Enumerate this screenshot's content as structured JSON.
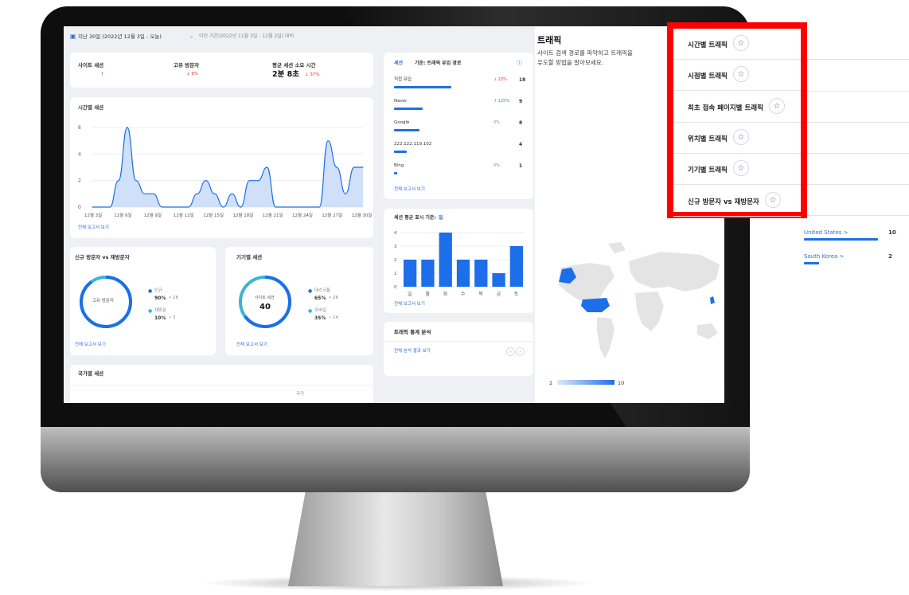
{
  "date_range": {
    "label": "지난 30일 (2022년 12월 3일 - 오늘)",
    "compare": "이전 기간(2022년 11월 3일 - 12월 2일) 대비"
  },
  "stats": {
    "site_sessions": {
      "label": "사이트 세션",
      "delta": "↑"
    },
    "unique_visitors": {
      "label": "고유 방문자",
      "delta": "↓ 6%"
    },
    "avg_duration": {
      "label": "평균 세션 소요 시간",
      "value": "2분 8초",
      "delta": "↓ 37%"
    }
  },
  "sessions_over_time": {
    "title": "시간별 세션",
    "report_link": "전체 보고서 보기"
  },
  "chart_data": [
    {
      "type": "area",
      "y_ticks": [
        "6",
        "4",
        "2",
        "0"
      ],
      "x_ticks": [
        "12월 3일",
        "12월 6일",
        "12월 9일",
        "12월 12일",
        "12월 15일",
        "12월 18일",
        "12월 21일",
        "12월 24일",
        "12월 27일",
        "12월 30일"
      ],
      "ylim": [
        0,
        6
      ],
      "values": [
        0,
        0,
        0,
        2,
        6,
        2,
        1,
        1,
        0,
        0,
        0,
        0,
        1,
        2,
        1,
        0,
        1,
        0,
        2,
        2,
        3,
        0,
        0,
        0,
        0,
        0,
        0,
        5,
        3,
        1,
        3,
        3
      ]
    },
    {
      "type": "bar",
      "categories": [
        "일",
        "월",
        "화",
        "수",
        "목",
        "금",
        "토"
      ],
      "y_ticks": [
        "4",
        "3",
        "2",
        "1",
        "0"
      ],
      "ylim": [
        0,
        4
      ],
      "values": [
        2,
        2,
        4,
        2,
        2,
        1,
        3
      ]
    }
  ],
  "new_vs_returning": {
    "title": "신규 방문자 vs 재방문자",
    "center": "고유 방문자",
    "items": [
      {
        "label": "신규",
        "pct": "90%",
        "count": "• 28",
        "color": "#1c6fe8"
      },
      {
        "label": "재방문",
        "pct": "10%",
        "count": "• 3",
        "color": "#3bb5d3"
      }
    ],
    "report_link": "전체 보고서 보기"
  },
  "device_sessions": {
    "title": "기기별 세션",
    "center_label": "사이트 세션",
    "center_value": "40",
    "items": [
      {
        "label": "데스크톱",
        "pct": "65%",
        "count": "• 26",
        "color": "#1c6fe8"
      },
      {
        "label": "모바일",
        "pct": "35%",
        "count": "• 14",
        "color": "#3bb5d3"
      }
    ],
    "report_link": "전체 보고서 보기"
  },
  "country_sessions": {
    "title": "국가별 세션",
    "column": "국가"
  },
  "traffic_sources": {
    "dropdown": "세션",
    "basis": "기준: 트래픽 유입 경로",
    "rows": [
      {
        "name": "직접 유입",
        "delta": "↓ 22%",
        "value": "18",
        "fill": 1.0,
        "dir": "down"
      },
      {
        "name": "Naver",
        "delta": "↑ 125%",
        "value": "9",
        "fill": 0.5,
        "dir": "up"
      },
      {
        "name": "Google",
        "delta": "0%",
        "value": "8",
        "fill": 0.44,
        "dir": "flat"
      },
      {
        "name": "222.122.119.102",
        "delta": "",
        "value": "4",
        "fill": 0.22,
        "dir": "flat"
      },
      {
        "name": "Bing",
        "delta": "0%",
        "value": "1",
        "fill": 0.06,
        "dir": "flat"
      }
    ],
    "report_link": "전체 보고서 보기"
  },
  "avg_sessions": {
    "title": "세션 평균 표시 기준:",
    "unit": "일",
    "report_link": "전체 보고서 보기"
  },
  "traffic_insights": {
    "title": "트래픽 통계 분석",
    "link": "전체 분석 결과 보기"
  },
  "traffic_panel": {
    "title": "트래픽",
    "description_line1": "사이트 검색 경로를 파악하고 트래픽을",
    "description_line2": "유도할 방법을 알아보세요.",
    "legend_min": "2",
    "legend_max": "10"
  },
  "traffic_menu": [
    {
      "label": "시간별 트래픽"
    },
    {
      "label": "시점별 트래픽"
    },
    {
      "label": "최초 접속 페이지별 트래픽"
    },
    {
      "label": "위치별 트래픽"
    },
    {
      "label": "기기별 트래픽"
    },
    {
      "label": "신규 방문자 vs 재방문자"
    }
  ],
  "countries": [
    {
      "name": "United States >",
      "value": "10",
      "fill": 1.0
    },
    {
      "name": "South Korea >",
      "value": "2",
      "fill": 0.2
    }
  ],
  "icons": {
    "calendar": "calendar-icon",
    "star": "star-icon",
    "info": "info-icon"
  }
}
